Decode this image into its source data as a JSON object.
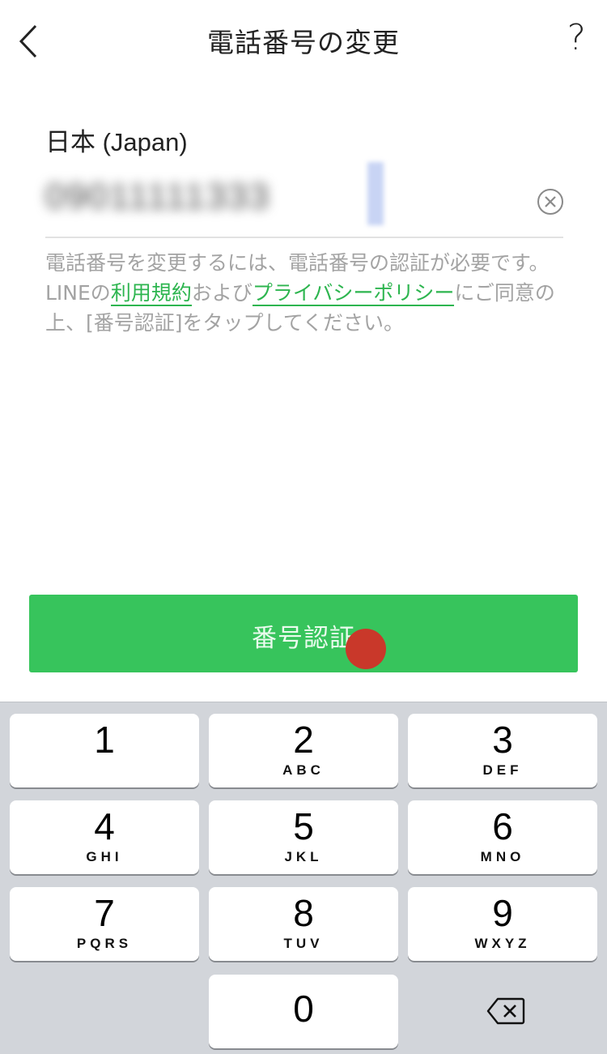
{
  "nav": {
    "title": "電話番号の変更",
    "help": "?"
  },
  "form": {
    "country": "日本 (Japan)",
    "phone_value": "09011111333",
    "notice_before": "電話番号を変更するには、電話番号の認証が必要です。LINEの",
    "terms_link": "利用規約",
    "notice_middle": "および",
    "privacy_link": "プライバシーポリシー",
    "notice_after": "にご同意の上、[番号認証]をタップしてください。"
  },
  "verify_button": {
    "label": "番号認証"
  },
  "keyboard": {
    "keys": [
      {
        "digit": "1",
        "letters": ""
      },
      {
        "digit": "2",
        "letters": "ABC"
      },
      {
        "digit": "3",
        "letters": "DEF"
      },
      {
        "digit": "4",
        "letters": "GHI"
      },
      {
        "digit": "5",
        "letters": "JKL"
      },
      {
        "digit": "6",
        "letters": "MNO"
      },
      {
        "digit": "7",
        "letters": "PQRS"
      },
      {
        "digit": "8",
        "letters": "TUV"
      },
      {
        "digit": "9",
        "letters": "WXYZ"
      },
      {
        "digit": "0",
        "letters": ""
      }
    ]
  },
  "colors": {
    "accent": "#37c45c",
    "link": "#2db54f",
    "tap_marker": "#c9382a",
    "keyboard_bg": "#d2d5da"
  },
  "icons": {
    "back": "chevron-left-icon",
    "clear": "clear-circle-icon",
    "delete": "backspace-icon"
  }
}
